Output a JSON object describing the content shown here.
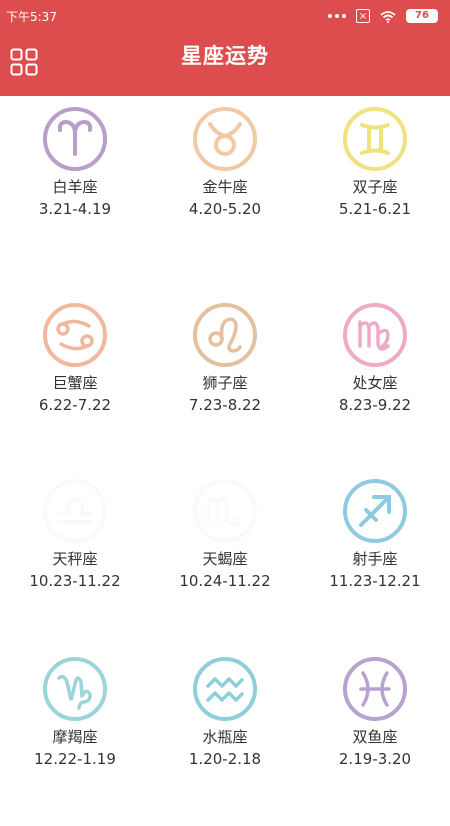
{
  "status": {
    "time": "下午5:37",
    "battery": "76"
  },
  "header": {
    "title": "星座运势"
  },
  "signs": [
    {
      "name": "白羊座",
      "dates": "3.21-4.19",
      "color": "#b79fca",
      "icon": "aries-icon"
    },
    {
      "name": "金牛座",
      "dates": "4.20-5.20",
      "color": "#f2c9a5",
      "icon": "taurus-icon"
    },
    {
      "name": "双子座",
      "dates": "5.21-6.21",
      "color": "#f0e27e",
      "icon": "gemini-icon"
    },
    {
      "name": "巨蟹座",
      "dates": "6.22-7.22",
      "color": "#f0b89c",
      "icon": "cancer-icon"
    },
    {
      "name": "狮子座",
      "dates": "7.23-8.22",
      "color": "#e4c09e",
      "icon": "leo-icon"
    },
    {
      "name": "处女座",
      "dates": "8.23-9.22",
      "color": "#eeaac6",
      "icon": "virgo-icon"
    },
    {
      "name": "天秤座",
      "dates": "10.23-11.22",
      "color": "#eeeeee",
      "icon": "libra-icon"
    },
    {
      "name": "天蝎座",
      "dates": "10.24-11.22",
      "color": "#eeeeee",
      "icon": "scorpio-icon"
    },
    {
      "name": "射手座",
      "dates": "11.23-12.21",
      "color": "#8fcbe0",
      "icon": "sagittarius-icon"
    },
    {
      "name": "摩羯座",
      "dates": "12.22-1.19",
      "color": "#9bd5d8",
      "icon": "capricorn-icon"
    },
    {
      "name": "水瓶座",
      "dates": "1.20-2.18",
      "color": "#8fcfd9",
      "icon": "aquarius-icon"
    },
    {
      "name": "双鱼座",
      "dates": "2.19-3.20",
      "color": "#b7a3cf",
      "icon": "pisces-icon"
    }
  ]
}
